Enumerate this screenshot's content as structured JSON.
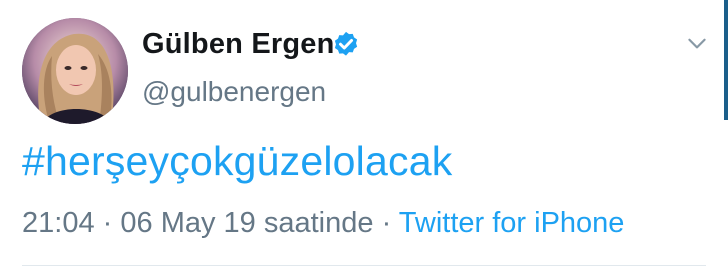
{
  "tweet": {
    "author": {
      "display_name": "Gülben Ergen",
      "handle": "@gulbenergen",
      "verified": true,
      "avatar_icon": "avatar"
    },
    "text": "#herşeyçokgüzelolacak",
    "meta": {
      "time": "21:04",
      "separator": "·",
      "date": "06 May 19 saatinde",
      "source": "Twitter for iPhone"
    },
    "menu_icon": "chevron-down-icon"
  },
  "colors": {
    "link": "#1da1f2",
    "secondary_text": "#657786",
    "primary_text": "#14171a",
    "verified": "#1da1f2"
  }
}
